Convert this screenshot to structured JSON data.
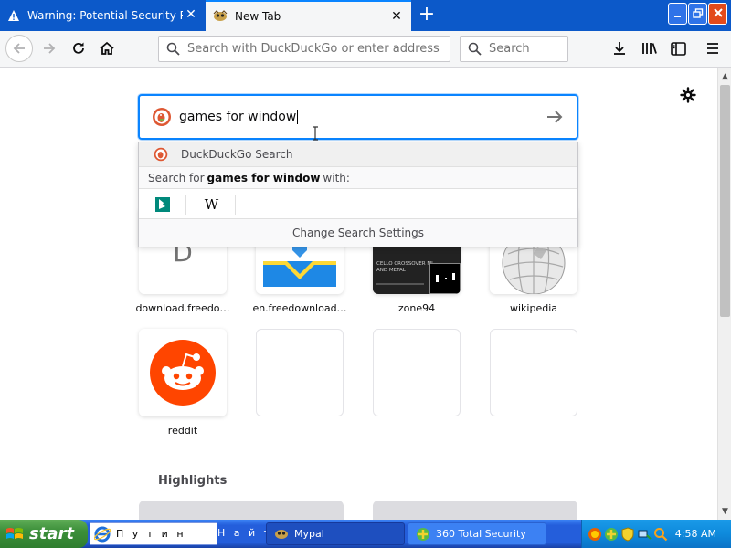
{
  "tabs": [
    {
      "label": "Warning: Potential Security Risk A",
      "icon": "warning-icon"
    },
    {
      "label": "New Tab",
      "icon": "mypal-icon"
    }
  ],
  "toolbar": {
    "url_placeholder": "Search with DuckDuckGo or enter address",
    "search_placeholder": "Search"
  },
  "search": {
    "query": "games for window",
    "engine_icon": "duckduckgo-icon"
  },
  "dropdown": {
    "engine_label": "DuckDuckGo Search",
    "search_for_prefix": "Search for",
    "search_for_query": "games for window",
    "search_for_suffix": "with:",
    "engines": [
      "bing-icon",
      "wikipedia-icon"
    ],
    "settings_label": "Change Search Settings"
  },
  "top_sites": [
    {
      "title": "download.freedo…",
      "letter": "D"
    },
    {
      "title": "en.freedownload…"
    },
    {
      "title": "zone94",
      "preview_lines": [
        "CELLO CROSSOVER MI…",
        "AND METAL"
      ]
    },
    {
      "title": "wikipedia"
    },
    {
      "title": "reddit"
    }
  ],
  "highlights_label": "Highlights",
  "taskbar": {
    "start_label": "start",
    "search_placeholder": "П у т и н",
    "find_label": "Н а й т и",
    "tasks": [
      {
        "label": "Mypal"
      },
      {
        "label": "360 Total Security"
      }
    ],
    "clock": "4:58 AM"
  },
  "colors": {
    "titlebar": "#0c59c9",
    "focus_ring": "#0a84ff",
    "reddit": "#ff4500",
    "taskbar": "#245edb",
    "start": "#3c8f3a"
  }
}
